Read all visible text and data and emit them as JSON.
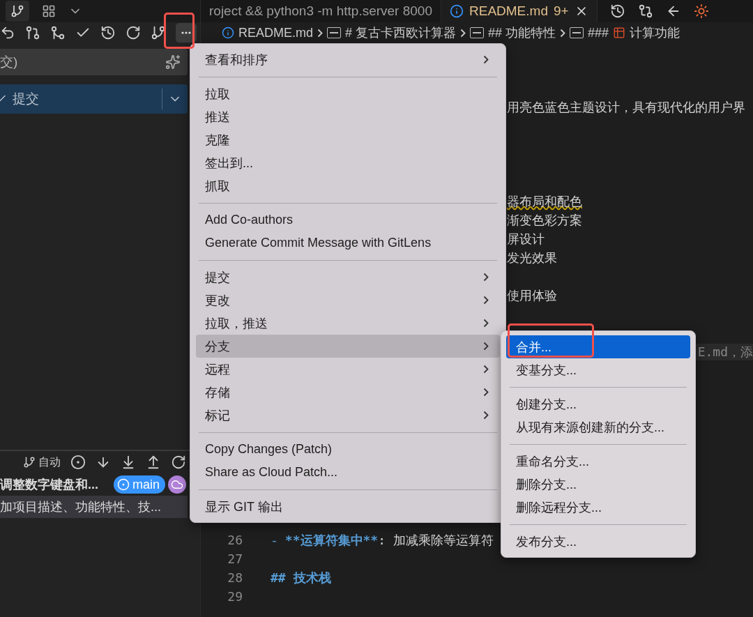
{
  "sidebar": {
    "commit_input": {
      "value": "交)"
    },
    "commit_button": {
      "label": "提交"
    },
    "graph": {
      "mode_label": "自动",
      "commits": [
        {
          "message": "调整数字键盘和...",
          "selected": false,
          "badges": [
            {
              "kind": "branch",
              "label": "main"
            },
            {
              "kind": "remote"
            }
          ]
        },
        {
          "message": "加项目描述、功能特性、技...",
          "selected": true
        }
      ]
    }
  },
  "editor": {
    "tabs": [
      {
        "label": "roject && python3 -m http.server 8000",
        "selected": false
      },
      {
        "label": "README.md",
        "problems": "9+",
        "selected": true
      }
    ],
    "breadcrumb": [
      {
        "kind": "file",
        "text": "README.md"
      },
      {
        "kind": "heading",
        "text": "# 复古卡西欧计算器"
      },
      {
        "kind": "heading",
        "text": "## 功能特性"
      },
      {
        "kind": "heading-icon",
        "text": "###",
        "suffix": "计算功能"
      }
    ],
    "lines": [
      {
        "kind": "blank"
      },
      {
        "kind": "blank"
      },
      {
        "kind": "tail",
        "text": "用亮色蓝色主题设计，具有现代化的用户界"
      },
      {
        "kind": "blank"
      },
      {
        "kind": "blank"
      },
      {
        "kind": "blank"
      },
      {
        "kind": "blank"
      },
      {
        "kind": "tail",
        "text": "器布局和配色",
        "warning": true
      },
      {
        "kind": "tail",
        "text": "渐变色彩方案"
      },
      {
        "kind": "tail",
        "text": "屏设计"
      },
      {
        "kind": "tail",
        "text": "发光效果"
      },
      {
        "kind": "blank"
      },
      {
        "kind": "tail",
        "text": "使用体验"
      },
      {
        "kind": "blank"
      },
      {
        "kind": "blank"
      },
      {
        "kind": "blame",
        "text": "E.md，添"
      },
      {
        "kind": "blank"
      },
      {
        "kind": "blank"
      },
      {
        "kind": "blank"
      },
      {
        "kind": "blank"
      },
      {
        "kind": "blank"
      },
      {
        "kind": "blank"
      },
      {
        "kind": "blank"
      },
      {
        "kind": "blank"
      },
      {
        "kind": "blank"
      },
      {
        "kind": "numbered",
        "number": "26",
        "segments": [
          {
            "kind": "marker",
            "text": "-"
          },
          {
            "kind": "strong",
            "text": "**运算符集中**"
          },
          {
            "kind": "plain",
            "text": ": 加减乘除等运算符"
          }
        ]
      },
      {
        "kind": "numbered",
        "number": "27"
      },
      {
        "kind": "numbered",
        "number": "28",
        "segments": [
          {
            "kind": "strong",
            "text": "## 技术栈"
          }
        ]
      },
      {
        "kind": "numbered",
        "number": "29"
      }
    ]
  },
  "context_menu": {
    "items": [
      {
        "kind": "item",
        "label": "查看和排序",
        "has_submenu": true,
        "selected": false
      },
      {
        "kind": "separator"
      },
      {
        "kind": "item",
        "label": "拉取",
        "has_submenu": false,
        "selected": false
      },
      {
        "kind": "item",
        "label": "推送",
        "has_submenu": false,
        "selected": false
      },
      {
        "kind": "item",
        "label": "克隆",
        "has_submenu": false,
        "selected": false
      },
      {
        "kind": "item",
        "label": "签出到...",
        "has_submenu": false,
        "selected": false
      },
      {
        "kind": "item",
        "label": "抓取",
        "has_submenu": false,
        "selected": false
      },
      {
        "kind": "separator"
      },
      {
        "kind": "item",
        "label": "Add Co-authors",
        "has_submenu": false,
        "selected": false
      },
      {
        "kind": "item",
        "label": "Generate Commit Message with GitLens",
        "has_submenu": false,
        "selected": false
      },
      {
        "kind": "separator"
      },
      {
        "kind": "item",
        "label": "提交",
        "has_submenu": true,
        "selected": false
      },
      {
        "kind": "item",
        "label": "更改",
        "has_submenu": true,
        "selected": false
      },
      {
        "kind": "item",
        "label": "拉取，推送",
        "has_submenu": true,
        "selected": false
      },
      {
        "kind": "item",
        "label": "分支",
        "has_submenu": true,
        "selected": true
      },
      {
        "kind": "item",
        "label": "远程",
        "has_submenu": true,
        "selected": false
      },
      {
        "kind": "item",
        "label": "存储",
        "has_submenu": true,
        "selected": false
      },
      {
        "kind": "item",
        "label": "标记",
        "has_submenu": true,
        "selected": false
      },
      {
        "kind": "separator"
      },
      {
        "kind": "item",
        "label": "Copy Changes (Patch)",
        "has_submenu": false,
        "selected": false
      },
      {
        "kind": "item",
        "label": "Share as Cloud Patch...",
        "has_submenu": false,
        "selected": false
      },
      {
        "kind": "separator"
      },
      {
        "kind": "item",
        "label": "显示 GIT 输出",
        "has_submenu": false,
        "selected": false
      }
    ]
  },
  "submenu": {
    "items": [
      {
        "kind": "item",
        "label": "合并...",
        "selected": true
      },
      {
        "kind": "item",
        "label": "变基分支...",
        "selected": false
      },
      {
        "kind": "separator"
      },
      {
        "kind": "item",
        "label": "创建分支...",
        "selected": false
      },
      {
        "kind": "item",
        "label": "从现有来源创建新的分支...",
        "selected": false
      },
      {
        "kind": "separator"
      },
      {
        "kind": "item",
        "label": "重命名分支...",
        "selected": false
      },
      {
        "kind": "item",
        "label": "删除分支...",
        "selected": false
      },
      {
        "kind": "item",
        "label": "删除远程分支...",
        "selected": false
      },
      {
        "kind": "separator"
      },
      {
        "kind": "item",
        "label": "发布分支...",
        "selected": false
      }
    ]
  }
}
